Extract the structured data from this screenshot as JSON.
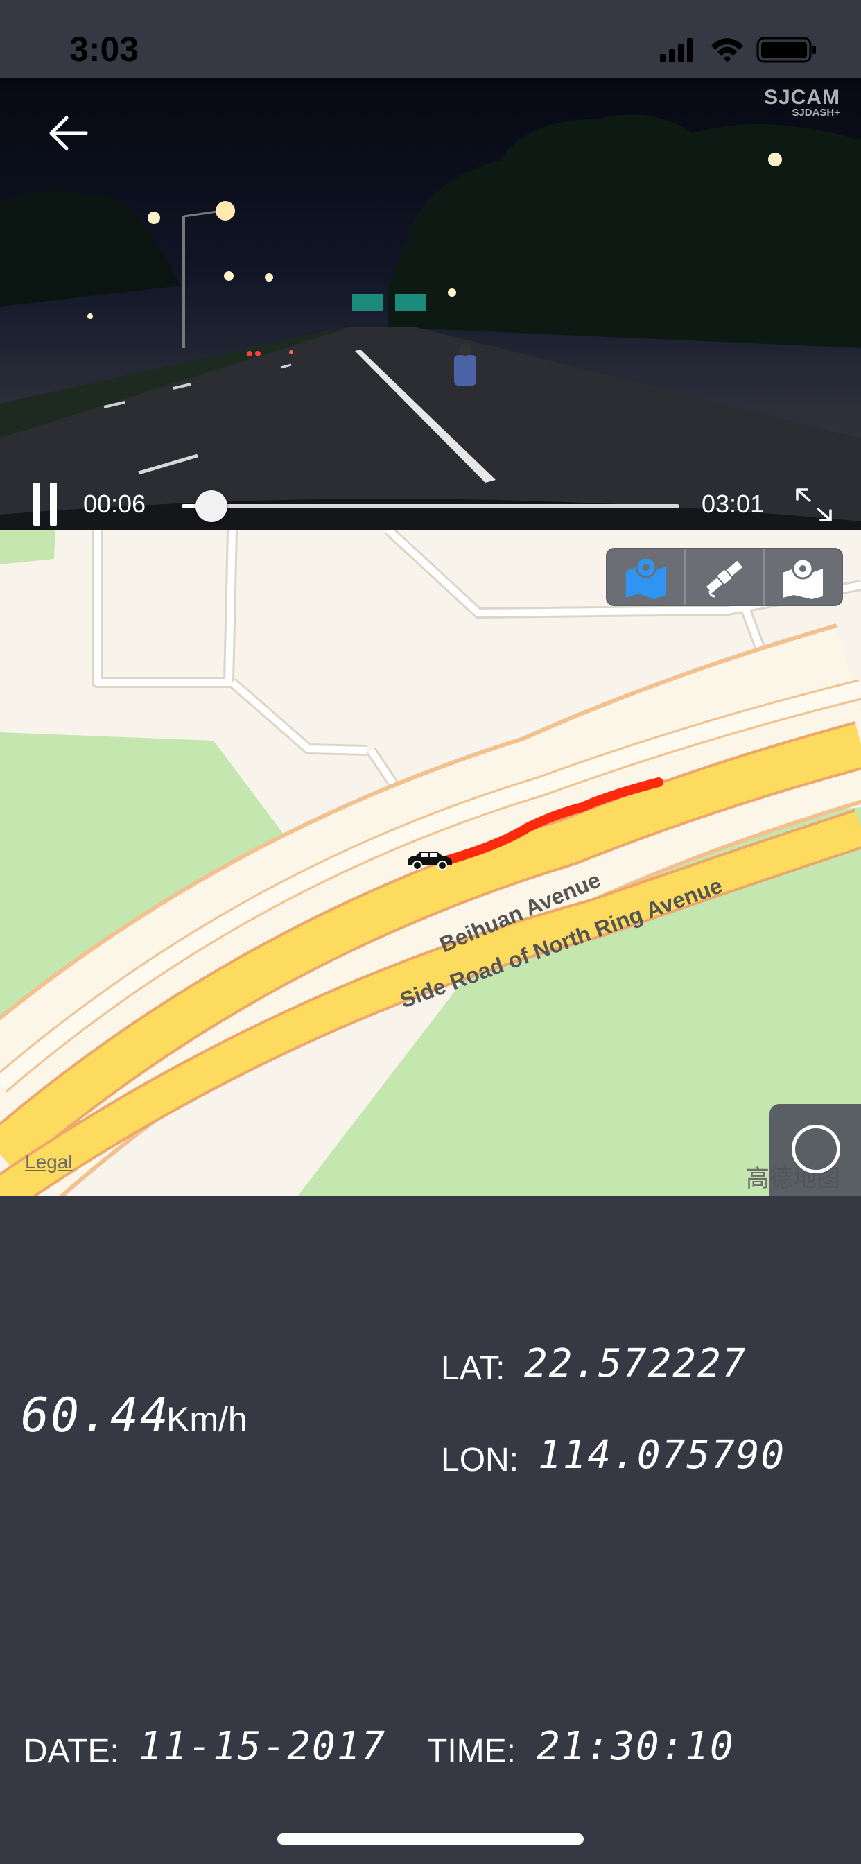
{
  "status_bar": {
    "time": "3:03"
  },
  "video": {
    "brand_line1": "SJCAM",
    "brand_line2": "SJDASH+",
    "current_time": "00:06",
    "total_time": "03:01",
    "progress": 0.033
  },
  "map": {
    "road_label_1": "Beihuan Avenue",
    "road_label_2": "Side Road of North Ring Avenue",
    "legal": "Legal",
    "provider": "高德地图",
    "tools": [
      "map-layer-icon",
      "satellite-icon",
      "map-pin-icon"
    ],
    "colors": {
      "track": "#ff2a0e",
      "road": "#fddb5f",
      "park": "#c3e7ae",
      "land": "#f8f4ec"
    }
  },
  "telemetry": {
    "speed": "60.44",
    "speed_unit": "Km/h",
    "lat_label": "LAT:",
    "lat": "22.572227",
    "lon_label": "LON:",
    "lon": "114.075790",
    "date_label": "DATE:",
    "date": "11-15-2017",
    "time_label": "TIME:",
    "time": "21:30:10"
  }
}
